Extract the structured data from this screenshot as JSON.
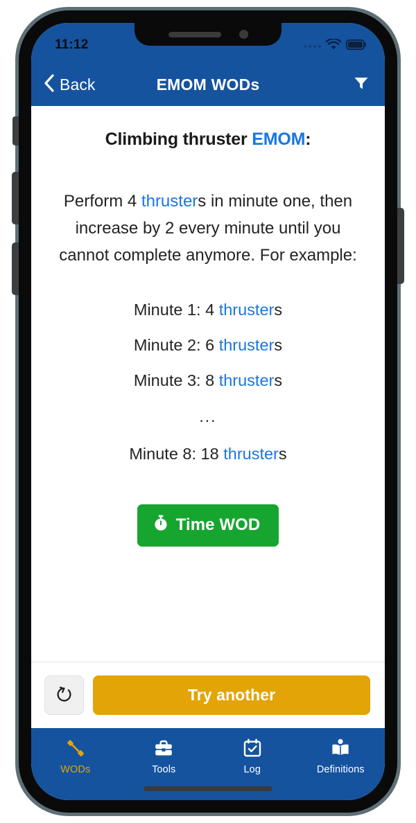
{
  "status_bar": {
    "time": "11:12",
    "signal_icon": "signal-dots-icon",
    "wifi_icon": "wifi-icon",
    "battery_icon": "battery-full-icon"
  },
  "nav": {
    "back_label": "Back",
    "back_icon": "chevron-left-icon",
    "title": "EMOM WODs",
    "filter_icon": "filter-funnel-icon"
  },
  "workout": {
    "title_prefix": "Climbing thruster ",
    "title_link": "EMOM",
    "title_suffix": ":",
    "desc_part1": "Perform 4 ",
    "desc_link": "thruster",
    "desc_part2": "s in minute one, then increase by 2 every minute until you cannot complete anymore. For example:",
    "lines": [
      {
        "prefix": "Minute 1: 4 ",
        "link": "thruster",
        "suffix": "s"
      },
      {
        "prefix": "Minute 2: 6 ",
        "link": "thruster",
        "suffix": "s"
      },
      {
        "prefix": "Minute 3: 8 ",
        "link": "thruster",
        "suffix": "s"
      },
      {
        "ellipsis": "..."
      },
      {
        "prefix": "Minute 8: 18 ",
        "link": "thruster",
        "suffix": "s"
      }
    ],
    "time_wod_label": "Time WOD",
    "time_wod_icon": "stopwatch-icon"
  },
  "actions": {
    "refresh_icon": "refresh-counterclockwise-icon",
    "try_another_label": "Try another"
  },
  "tabs": [
    {
      "label": "WODs",
      "icon": "dumbbell-icon",
      "active": true
    },
    {
      "label": "Tools",
      "icon": "toolbox-icon",
      "active": false
    },
    {
      "label": "Log",
      "icon": "calendar-check-icon",
      "active": false
    },
    {
      "label": "Definitions",
      "icon": "open-book-icon",
      "active": false
    }
  ],
  "colors": {
    "brand_blue": "#15539F",
    "link_blue": "#1877E0",
    "green": "#16A630",
    "amber": "#E3A408"
  }
}
